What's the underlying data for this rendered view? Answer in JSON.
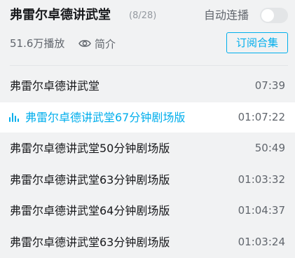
{
  "header": {
    "title": "弗雷尔卓德讲武堂",
    "episode_count": "(8/28)",
    "autoplay_label": "自动连播",
    "autoplay_on": false,
    "plays": "51.6万播放",
    "intro_label": "简介",
    "subscribe_label": "订阅合集"
  },
  "colors": {
    "accent": "#00aeec",
    "text": "#18191c",
    "secondary": "#61666d",
    "background": "#f1f2f3",
    "active_row": "#ffffff"
  },
  "episodes": [
    {
      "title": "弗雷尔卓德讲武堂",
      "duration": "07:39",
      "active": false
    },
    {
      "title": "弗雷尔卓德讲武堂67分钟剧场版",
      "duration": "01:07:22",
      "active": true
    },
    {
      "title": "弗雷尔卓德讲武堂50分钟剧场版",
      "duration": "50:49",
      "active": false
    },
    {
      "title": "弗雷尔卓德讲武堂63分钟剧场版",
      "duration": "01:03:32",
      "active": false
    },
    {
      "title": "弗雷尔卓德讲武堂64分钟剧场版",
      "duration": "01:04:37",
      "active": false
    },
    {
      "title": "弗雷尔卓德讲武堂63分钟剧场版",
      "duration": "01:03:24",
      "active": false
    }
  ]
}
